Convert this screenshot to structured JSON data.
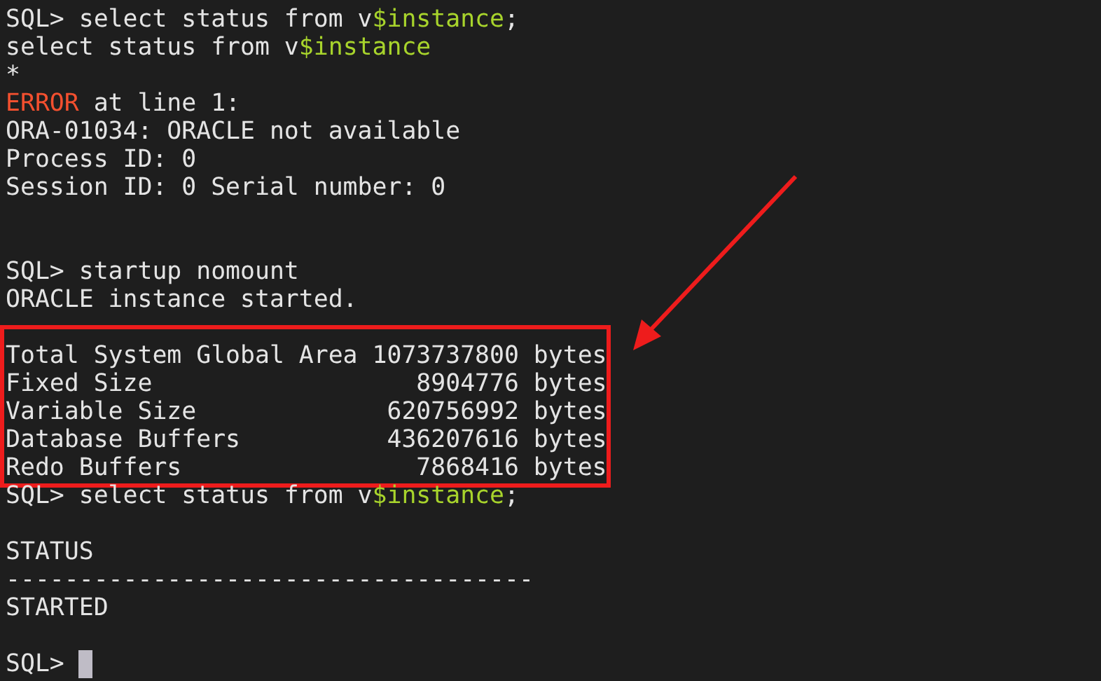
{
  "terminal": [
    {
      "kind": "line",
      "segments": [
        {
          "kind": "plain",
          "text": "SQL> select status from v"
        },
        {
          "kind": "keyword",
          "text": "$instance"
        },
        {
          "kind": "plain",
          "text": ";"
        }
      ]
    },
    {
      "kind": "line",
      "segments": [
        {
          "kind": "plain",
          "text": "select status from v"
        },
        {
          "kind": "keyword",
          "text": "$instance"
        }
      ]
    },
    {
      "kind": "line",
      "segments": [
        {
          "kind": "plain",
          "text": "*"
        }
      ]
    },
    {
      "kind": "line",
      "segments": [
        {
          "kind": "error",
          "text": "ERROR"
        },
        {
          "kind": "plain",
          "text": " at line 1:"
        }
      ]
    },
    {
      "kind": "line",
      "segments": [
        {
          "kind": "plain",
          "text": "ORA-01034: ORACLE not available"
        }
      ]
    },
    {
      "kind": "line",
      "segments": [
        {
          "kind": "plain",
          "text": "Process ID: 0"
        }
      ]
    },
    {
      "kind": "line",
      "segments": [
        {
          "kind": "plain",
          "text": "Session ID: 0 Serial number: 0"
        }
      ]
    },
    {
      "kind": "blank"
    },
    {
      "kind": "blank"
    },
    {
      "kind": "line",
      "segments": [
        {
          "kind": "plain",
          "text": "SQL> startup nomount"
        }
      ]
    },
    {
      "kind": "line",
      "segments": [
        {
          "kind": "plain",
          "text": "ORACLE instance started."
        }
      ]
    },
    {
      "kind": "blank"
    },
    {
      "kind": "boxed",
      "lines": [
        "Total System Global Area 1073737800 bytes",
        "Fixed Size                  8904776 bytes",
        "Variable Size             620756992 bytes",
        "Database Buffers          436207616 bytes",
        "Redo Buffers                7868416 bytes"
      ]
    },
    {
      "kind": "line",
      "segments": [
        {
          "kind": "plain",
          "text": "SQL> select status from v"
        },
        {
          "kind": "keyword",
          "text": "$instance"
        },
        {
          "kind": "plain",
          "text": ";"
        }
      ]
    },
    {
      "kind": "blank"
    },
    {
      "kind": "line",
      "segments": [
        {
          "kind": "plain",
          "text": "STATUS"
        }
      ]
    },
    {
      "kind": "line",
      "segments": [
        {
          "kind": "plain",
          "text": "------------------------------------"
        }
      ]
    },
    {
      "kind": "line",
      "segments": [
        {
          "kind": "plain",
          "text": "STARTED"
        }
      ]
    },
    {
      "kind": "blank"
    },
    {
      "kind": "line",
      "cursor": true,
      "segments": [
        {
          "kind": "plain",
          "text": "SQL> "
        }
      ]
    }
  ]
}
